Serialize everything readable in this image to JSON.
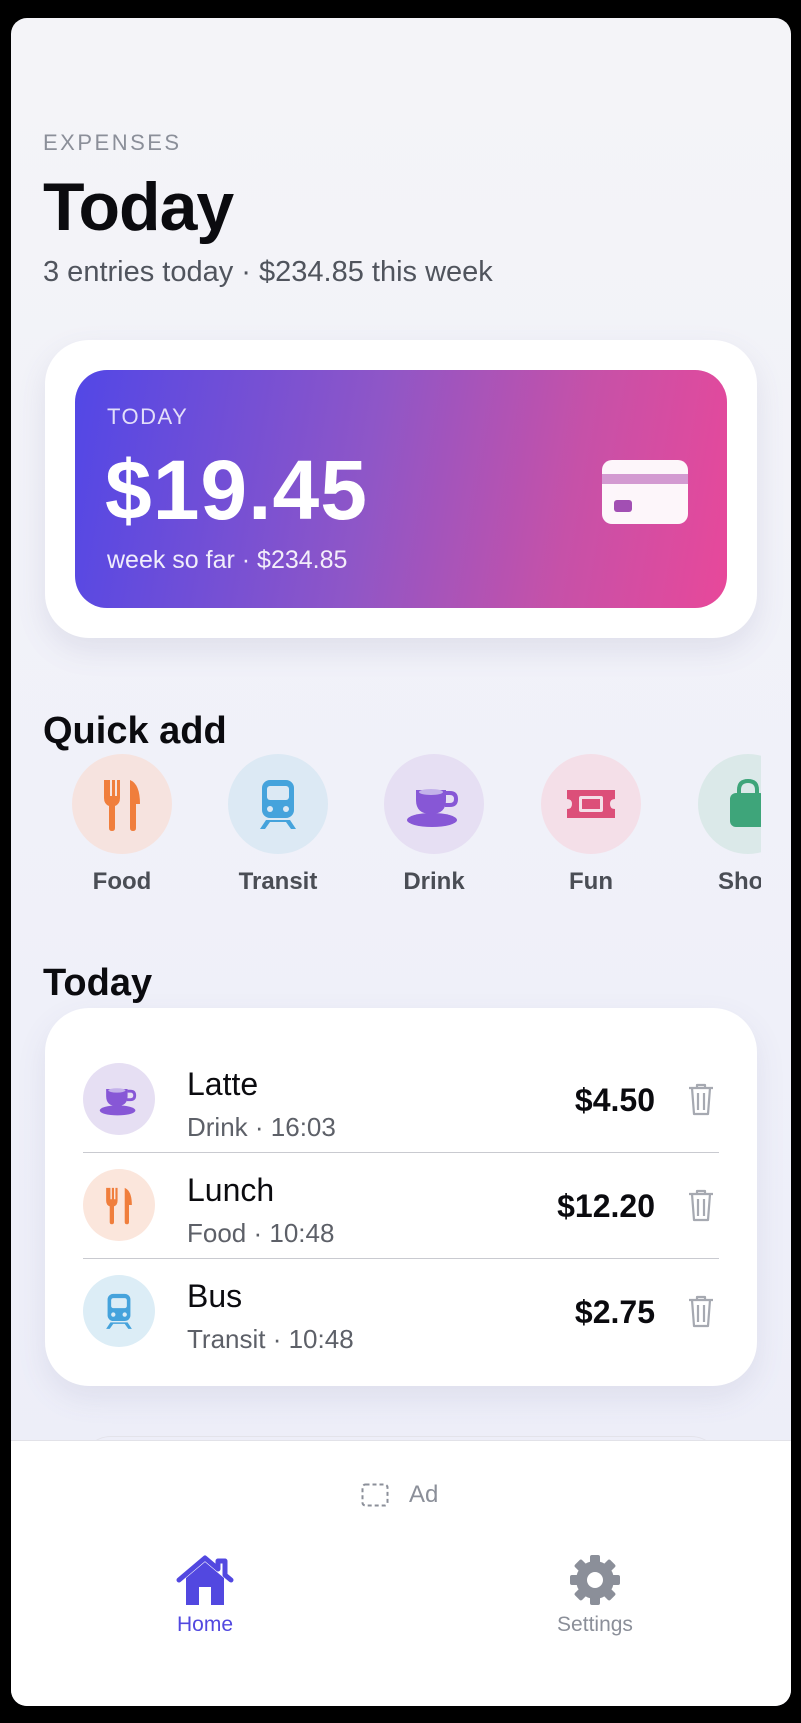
{
  "header": {
    "eyebrow": "EXPENSES",
    "title": "Today",
    "subtitle": "3 entries today · $234.85 this week"
  },
  "summary": {
    "label": "TODAY",
    "amount": "$19.45",
    "sub": "week so far · $234.85",
    "icon": "credit-card-icon",
    "gradient": [
      "#5247e6",
      "#e8489a"
    ]
  },
  "quick_add": {
    "title": "Quick add",
    "items": [
      {
        "label": "Food",
        "icon": "fork-knife-icon",
        "color": "#f07e3c",
        "bg": "#f6e3df"
      },
      {
        "label": "Transit",
        "icon": "train-icon",
        "color": "#45a3dc",
        "bg": "#dce9f4"
      },
      {
        "label": "Drink",
        "icon": "coffee-cup-icon",
        "color": "#8757d6",
        "bg": "#e6dff3"
      },
      {
        "label": "Fun",
        "icon": "ticket-icon",
        "color": "#dc4f79",
        "bg": "#f4dfe8"
      },
      {
        "label": "Shop",
        "icon": "bag-icon",
        "color": "#3ea57a",
        "bg": "#dbe9e9"
      }
    ]
  },
  "today_list": {
    "title": "Today",
    "entries": [
      {
        "name": "Latte",
        "meta": "Drink · 16:03",
        "amount": "$4.50",
        "icon": "coffee-cup-icon"
      },
      {
        "name": "Lunch",
        "meta": "Food · 10:48",
        "amount": "$12.20",
        "icon": "fork-knife-icon"
      },
      {
        "name": "Bus",
        "meta": "Transit · 10:48",
        "amount": "$2.75",
        "icon": "train-icon"
      }
    ]
  },
  "ad": {
    "label": "Ad"
  },
  "tabs": [
    {
      "label": "Home",
      "icon": "home-icon",
      "active": true,
      "color": "#5248e0"
    },
    {
      "label": "Settings",
      "icon": "gear-icon",
      "active": false,
      "color": "#8b8f99"
    }
  ]
}
